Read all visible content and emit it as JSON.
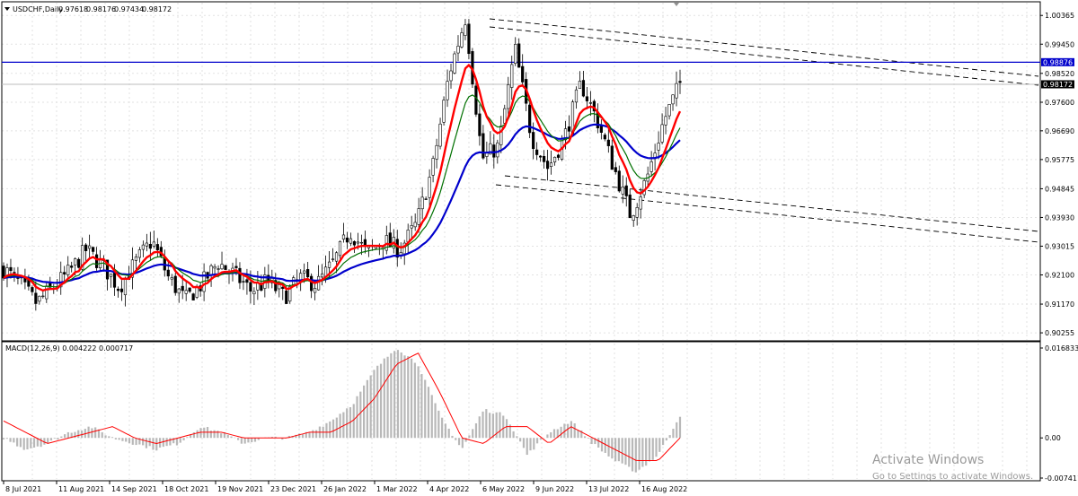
{
  "header": {
    "symbol": "USDCHF,Daily",
    "open": "0.97618",
    "high": "0.98176",
    "low": "0.97434",
    "close": "0.98172"
  },
  "price_axis": {
    "ticks": [
      "1.00365",
      "0.99450",
      "0.98520",
      "0.97600",
      "0.96690",
      "0.95775",
      "0.94845",
      "0.93930",
      "0.93015",
      "0.92100",
      "0.91170",
      "0.90255"
    ],
    "hline_label": "0.98876",
    "current_label": "0.98172"
  },
  "macd": {
    "label": "MACD(12,26,9) 0.004222 0.000717",
    "ticks": [
      "0.016833",
      "0.00",
      "-0.007411"
    ]
  },
  "time_axis": {
    "labels": [
      "8 Jul 2021",
      "11 Aug 2021",
      "14 Sep 2021",
      "18 Oct 2021",
      "19 Nov 2021",
      "23 Dec 2021",
      "26 Jan 2022",
      "1 Mar 2022",
      "4 Apr 2022",
      "6 May 2022",
      "9 Jun 2022",
      "13 Jul 2022",
      "16 Aug 2022"
    ]
  },
  "watermark": {
    "line1": "Activate Windows",
    "line2": "Go to Settings to activate Windows."
  },
  "colors": {
    "ma_fast": "#ff0000",
    "ma_mid": "#007000",
    "ma_slow": "#0000cc",
    "hline": "#0000cc",
    "signal": "#ff0000",
    "histogram": "#b8b8b8"
  },
  "chart_data": [
    {
      "type": "candlestick",
      "title": "USDCHF,Daily",
      "ylim": [
        0.9,
        1.008
      ],
      "x_dates": [
        "8 Jul 2021",
        "11 Aug 2021",
        "14 Sep 2021",
        "18 Oct 2021",
        "19 Nov 2021",
        "23 Dec 2021",
        "26 Jan 2022",
        "1 Mar 2022",
        "4 Apr 2022",
        "6 May 2022",
        "9 Jun 2022",
        "13 Jul 2022",
        "16 Aug 2022"
      ],
      "close_path": [
        0.923,
        0.918,
        0.912,
        0.917,
        0.922,
        0.929,
        0.924,
        0.917,
        0.925,
        0.932,
        0.92,
        0.913,
        0.918,
        0.925,
        0.921,
        0.916,
        0.919,
        0.914,
        0.92,
        0.918,
        0.925,
        0.935,
        0.928,
        0.932,
        0.929,
        0.937,
        0.955,
        0.985,
        1.003,
        0.958,
        0.962,
        0.993,
        0.965,
        0.955,
        0.965,
        0.982,
        0.97,
        0.955,
        0.94,
        0.952,
        0.97,
        0.982
      ],
      "horizontal_line": 0.98876,
      "last_price": 0.98172,
      "grid": true
    },
    {
      "type": "line",
      "title": "MACD(12,26,9) 0.004222 0.000717",
      "ylim": [
        -0.007411,
        0.016833
      ],
      "histogram_path": [
        0.0,
        -0.002,
        -0.001,
        0.001,
        0.002,
        0.0,
        -0.001,
        -0.002,
        -0.001,
        0.002,
        0.001,
        -0.001,
        0.0,
        0.0,
        0.001,
        0.003,
        0.006,
        0.012,
        0.016,
        0.013,
        0.004,
        -0.002,
        0.005,
        0.004,
        -0.003,
        0.001,
        0.003,
        -0.001,
        -0.004,
        -0.006,
        -0.003,
        0.004
      ],
      "signal_path": [
        0.003,
        0.001,
        -0.001,
        0.0,
        0.001,
        0.002,
        0.0,
        -0.001,
        0.0,
        0.001,
        0.001,
        0.0,
        0.0,
        0.0,
        0.001,
        0.001,
        0.003,
        0.007,
        0.013,
        0.015,
        0.008,
        0.0,
        -0.001,
        0.002,
        0.002,
        -0.001,
        0.002,
        0.0,
        -0.002,
        -0.004,
        -0.004,
        0.0
      ]
    }
  ]
}
